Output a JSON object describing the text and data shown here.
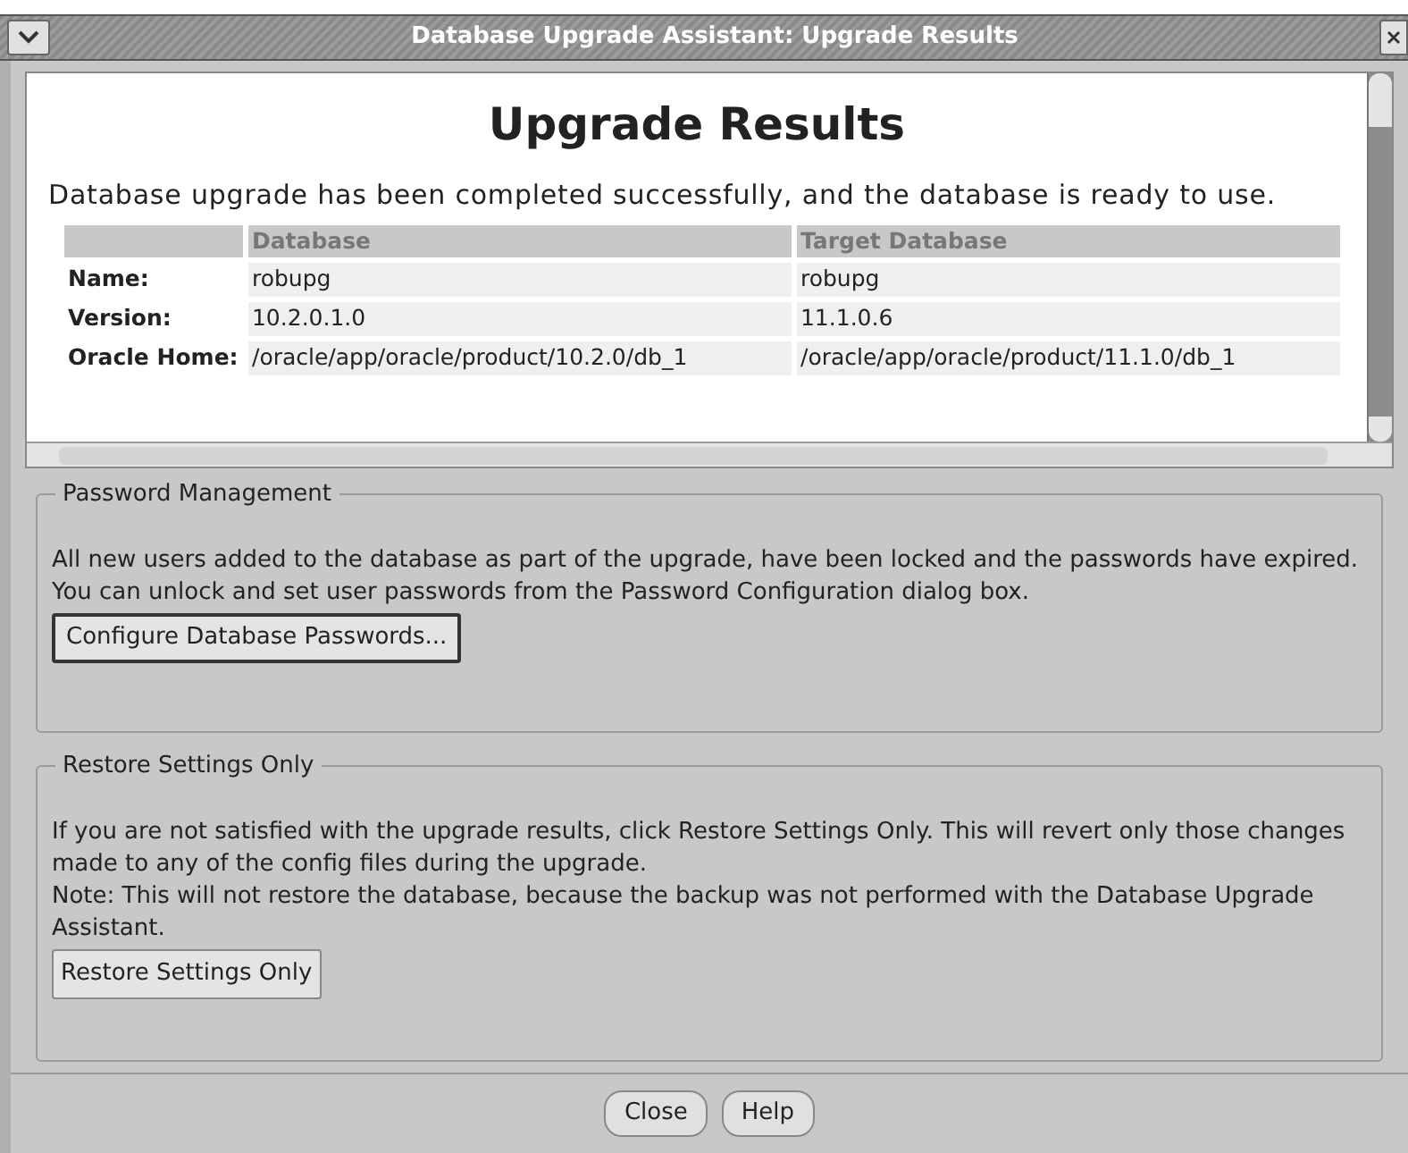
{
  "window": {
    "title": "Database Upgrade Assistant: Upgrade Results"
  },
  "results": {
    "heading": "Upgrade Results",
    "message": "Database upgrade has been completed successfully, and the database is ready to use.",
    "table": {
      "columns": [
        "Database",
        "Target Database"
      ],
      "rows": [
        {
          "label": "Name:",
          "values": [
            "robupg",
            "robupg"
          ]
        },
        {
          "label": "Version:",
          "values": [
            "10.2.0.1.0",
            "11.1.0.6"
          ]
        },
        {
          "label": "Oracle Home:",
          "values": [
            "/oracle/app/oracle/product/10.2.0/db_1",
            "/oracle/app/oracle/product/11.1.0/db_1"
          ]
        }
      ]
    }
  },
  "password_management": {
    "title": "Password Management",
    "text": "All new users added to the database as part of the upgrade, have been locked and the passwords have expired. You can unlock and set user passwords from the Password Configuration dialog box.",
    "button": "Configure Database Passwords..."
  },
  "restore_settings": {
    "title": "Restore Settings Only",
    "text": "If you are not satisfied with the upgrade results, click Restore Settings Only. This will revert only those changes made to any of the config files during the upgrade.",
    "note": "Note: This will not restore the database, because the backup was not performed with the Database Upgrade Assistant.",
    "button": "Restore Settings Only"
  },
  "buttons": [
    "Close",
    "Help"
  ]
}
